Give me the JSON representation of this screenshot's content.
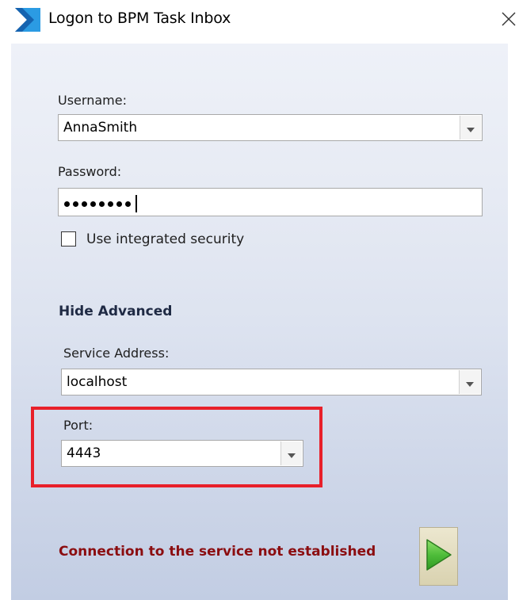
{
  "window": {
    "title": "Logon to BPM Task Inbox"
  },
  "form": {
    "username_label": "Username:",
    "username_value": "AnnaSmith",
    "password_label": "Password:",
    "password_masked_length": 8,
    "integrated_security_label": "Use integrated security",
    "integrated_security_checked": false,
    "advanced_toggle_label": "Hide Advanced",
    "service_address_label": "Service Address:",
    "service_address_value": "localhost",
    "port_label": "Port:",
    "port_value": "4443"
  },
  "status": {
    "message": "Connection to the service not established"
  },
  "icons": {
    "app": "bpm-logo-icon",
    "close": "close-icon",
    "dropdown": "chevron-down-icon",
    "go": "play-arrow-icon"
  },
  "colors": {
    "status_text": "#8b0d10",
    "highlight_border": "#e8202a",
    "logo_blue": "#1e88d6",
    "go_arrow": "#4caf50"
  }
}
